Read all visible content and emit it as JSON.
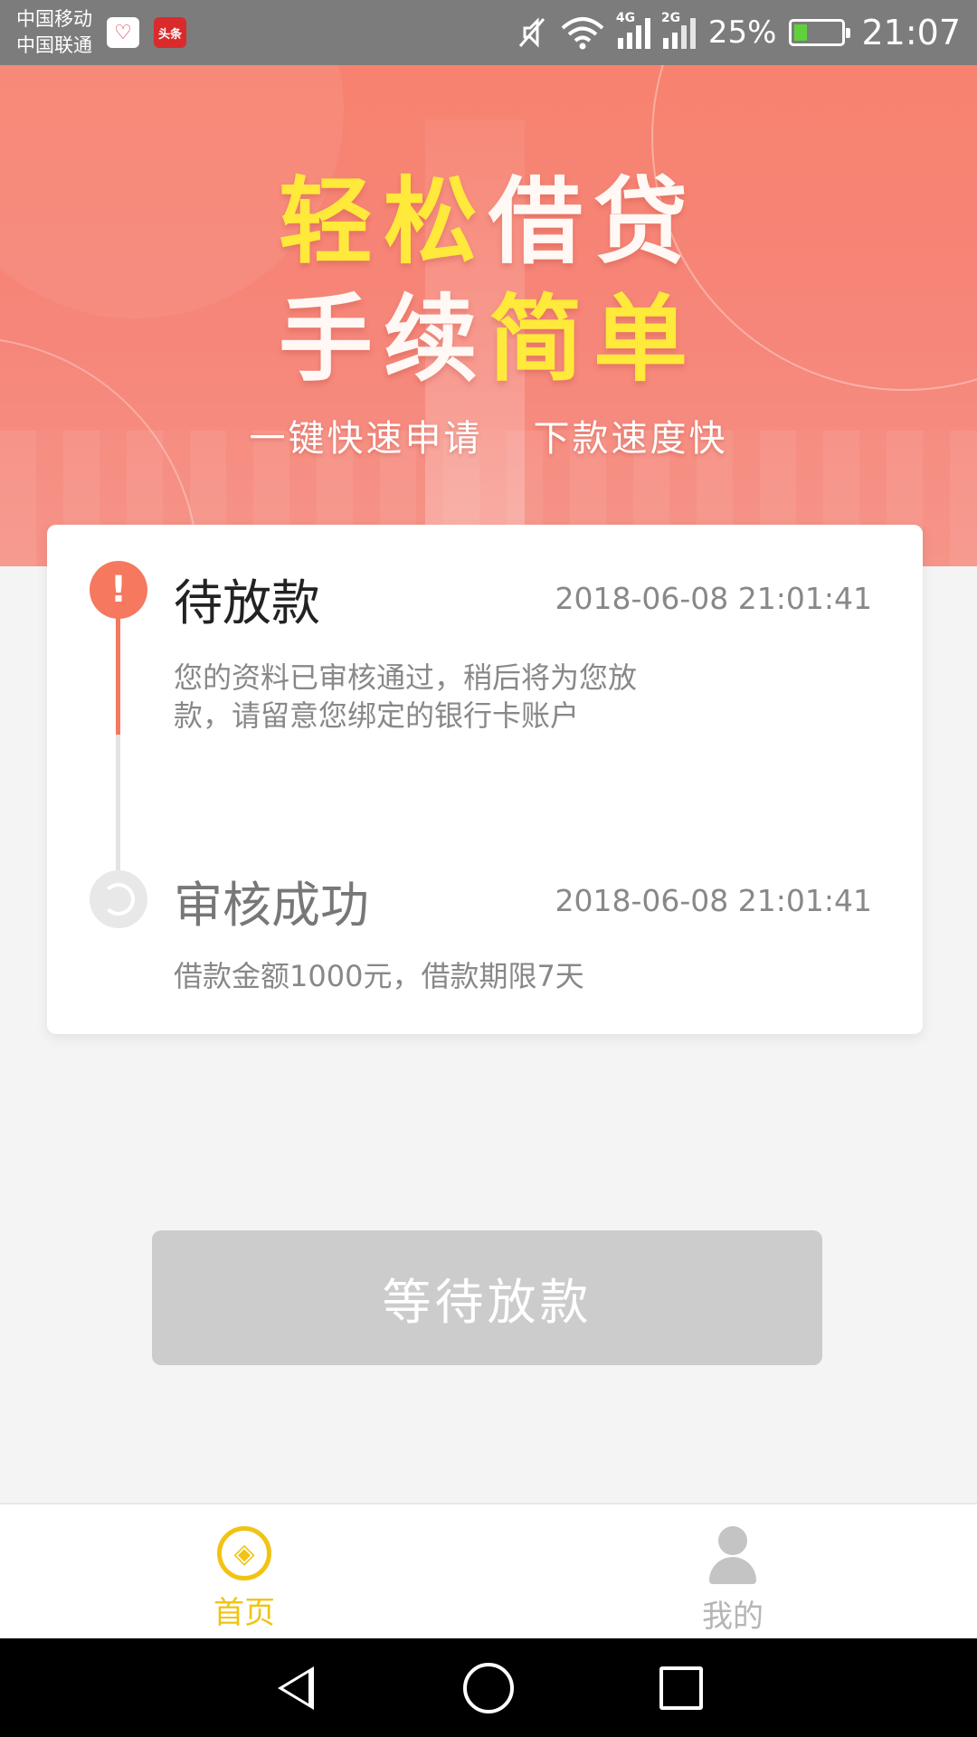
{
  "status_bar": {
    "carrier_1": "中国移动",
    "carrier_2": "中国联通",
    "news_app_label": "头条",
    "net_1": "4G",
    "net_2": "2G",
    "battery_percent": "25%",
    "time": "21:07",
    "battery_fill_fraction": 0.25
  },
  "banner": {
    "line1_a": "轻松",
    "line1_b": "借贷",
    "line2_a": "手续",
    "line2_b": "简单",
    "sub_1": "一键快速申请",
    "sub_2": "下款速度快",
    "highlight_color": "#ffe93b"
  },
  "progress": {
    "steps": [
      {
        "title": "待放款",
        "time": "2018-06-08 21:01:41",
        "desc": "您的资料已审核通过，稍后将为您放款，请留意您绑定的银行卡账户",
        "status": "pending",
        "icon": "alert-icon"
      },
      {
        "title": "审核成功",
        "time": "2018-06-08 21:01:41",
        "desc": "借款金额1000元，借款期限7天",
        "status": "done",
        "icon": "refresh-icon"
      }
    ],
    "accent_color": "#f5785f"
  },
  "action": {
    "button_label": "等待放款"
  },
  "bottom_nav": {
    "items": [
      {
        "label": "首页",
        "icon": "home-coin-icon",
        "active": true
      },
      {
        "label": "我的",
        "icon": "user-icon",
        "active": false
      }
    ],
    "active_color": "#f2c313"
  }
}
